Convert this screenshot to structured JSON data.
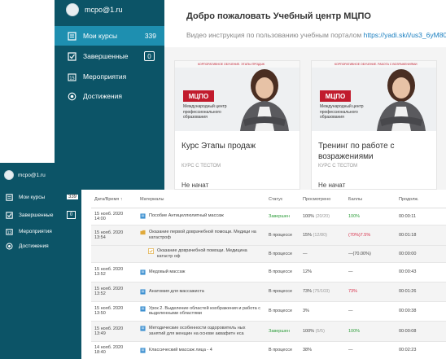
{
  "back_window": {
    "user_email": "mcpo@1.ru",
    "nav": [
      {
        "label": "Мои курсы",
        "count": "339",
        "icon": "book-icon",
        "active": true
      },
      {
        "label": "Завершенные",
        "badge": "0",
        "icon": "checkbox-icon",
        "active": false
      },
      {
        "label": "Мероприятия",
        "icon": "calendar-icon",
        "active": false
      },
      {
        "label": "Достижения",
        "icon": "award-icon",
        "active": false
      }
    ],
    "header": {
      "title": "Добро пожаловать Учебный центр МЦПО",
      "video_text": "Видео инструкция по пользованию учебным порталом",
      "video_link": "https://yadi.sk/i/us3_6yM80Cnk6Q"
    },
    "cards": [
      {
        "banner": "КОРПОРАТИВНОЕ ОБУЧЕНИЕ. ЭТАПЫ ПРОДАЖ",
        "logo": "МЦПО",
        "logo_caption": "Международный центр профессионального образования",
        "title": "Курс Этапы продаж",
        "type": "КУРС С ТЕСТОМ",
        "status": "Не начат"
      },
      {
        "banner": "КОРПОРАТИВНОЕ ОБУЧЕНИЕ. РАБОТА С ВОЗРАЖЕНИЯМИ",
        "logo": "МЦПО",
        "logo_caption": "Международный центр профессионального образования",
        "title": "Тренинг по работе с возражениями",
        "type": "КУРС С ТЕСТОМ",
        "status": "Не начат"
      }
    ]
  },
  "front_window": {
    "user_email": "mcpo@1.ru",
    "nav": [
      {
        "label": "Мои курсы",
        "count": "339",
        "icon": "book-icon"
      },
      {
        "label": "Завершенные",
        "badge": "0",
        "icon": "checkbox-icon"
      },
      {
        "label": "Мероприятия",
        "icon": "calendar-icon"
      },
      {
        "label": "Достижения",
        "icon": "award-icon"
      }
    ],
    "table": {
      "headers": [
        "Дата/Время ↑",
        "Материалы",
        "Статус",
        "Просмотрено",
        "Баллы",
        "Продолж."
      ],
      "rows": [
        {
          "date": "15 нояб. 2020",
          "time": "14:00",
          "material": "Пособие Антицеллюлитный массаж",
          "icon": "doc-icon",
          "status": "Завершен",
          "viewed": "100%",
          "viewed_extra": "(20/20)",
          "score": "100%",
          "duration": "00:00:11"
        },
        {
          "date": "15 нояб. 2020",
          "time": "13:54",
          "material": "Оказание первой доврачебной помощи. Медици на катастроф",
          "icon": "folder-icon",
          "status": "В процессе",
          "viewed": "15%",
          "viewed_extra": "(12/80)",
          "score": "(70%)7.5%",
          "duration": "00:01:18"
        },
        {
          "date": "",
          "time": "",
          "material": "Оказание доврачебной помощи. Медицина катастр оф",
          "icon": "check-doc-icon",
          "status": "В процессе",
          "viewed": "—",
          "viewed_extra": "",
          "score": "—(70.00%)",
          "duration": "00:00:00"
        },
        {
          "date": "15 нояб. 2020",
          "time": "13:52",
          "material": "Медовый массаж",
          "icon": "doc-icon",
          "status": "В процессе",
          "viewed": "12%",
          "viewed_extra": "",
          "score": "—",
          "duration": "00:00:43"
        },
        {
          "date": "15 нояб. 2020",
          "time": "13:52",
          "material": "Анатомия для массажиста",
          "icon": "doc-icon",
          "status": "В процессе",
          "viewed": "73%",
          "viewed_extra": "(75/103)",
          "score": "73%",
          "duration": "00:01:26"
        },
        {
          "date": "15 нояб. 2020",
          "time": "13:50",
          "material": "Урок 2. Выделение областей изображения и работа с выделенными областями",
          "icon": "doc-icon",
          "status": "В процессе",
          "viewed": "3%",
          "viewed_extra": "",
          "score": "—",
          "duration": "00:00:38"
        },
        {
          "date": "15 нояб. 2020",
          "time": "13:49",
          "material": "Методические особенности оздоровитель ных занятий для женщин на основе аквафитн еса",
          "icon": "doc-icon",
          "status": "Завершен",
          "viewed": "100%",
          "viewed_extra": "(5/5)",
          "score": "100%",
          "duration": "00:00:08"
        },
        {
          "date": "14 нояб. 2020",
          "time": "18:40",
          "material": "Классический массаж лица - 4",
          "icon": "doc-icon",
          "status": "В процессе",
          "viewed": "38%",
          "viewed_extra": "",
          "score": "—",
          "duration": "00:02:23"
        }
      ]
    }
  },
  "colors": {
    "sidebar": "#0c5467",
    "active": "#1e8fb0",
    "green": "#2d9d3a",
    "red": "#d9304b",
    "link": "#1a7fc0",
    "brand_red": "#c11b2d"
  }
}
